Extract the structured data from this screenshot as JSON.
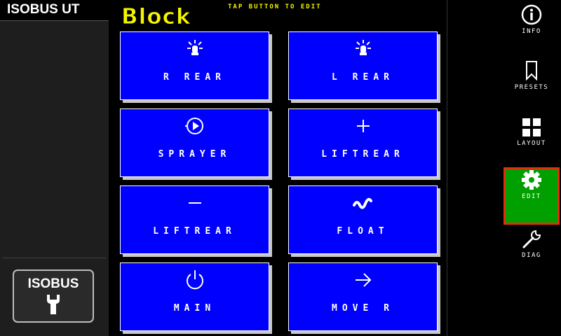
{
  "app": {
    "title": "ISOBUS UT"
  },
  "logo": {
    "text": "ISOBUS"
  },
  "header": {
    "title": "Block",
    "hint": "TAP BUTTON TO EDIT"
  },
  "blocks": [
    {
      "label": "R REAR",
      "icon": "lamp-icon"
    },
    {
      "label": "L REAR",
      "icon": "lamp-icon"
    },
    {
      "label": "SPRAYER",
      "icon": "play-circle-icon"
    },
    {
      "label": "LIFTREAR",
      "icon": "plus-icon"
    },
    {
      "label": "LIFTREAR",
      "icon": "minus-icon"
    },
    {
      "label": "FLOAT",
      "icon": "wave-icon"
    },
    {
      "label": "MAIN",
      "icon": "power-icon"
    },
    {
      "label": "MOVE R",
      "icon": "arrow-right-icon"
    }
  ],
  "toolbar": {
    "info": "INFO",
    "presets": "PRESETS",
    "layout": "LAYOUT",
    "edit": "EDIT",
    "diag": "DIAG",
    "active": "EDIT"
  },
  "colors": {
    "button_blue": "#0000ff",
    "title_yellow": "#f5f500",
    "active_green": "#00a000",
    "active_border": "#e03010"
  }
}
